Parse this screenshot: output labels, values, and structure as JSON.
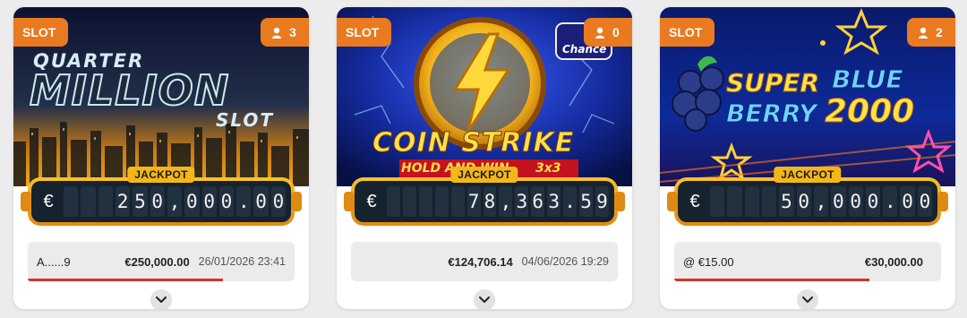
{
  "games": [
    {
      "category": "SLOT",
      "players": "3",
      "art_title": [
        "QUARTER",
        "MILLION",
        "SLOT"
      ],
      "jackpot_label": "JACKPOT",
      "currency": "€",
      "digits": [
        "",
        "",
        "",
        "2",
        "5",
        "0",
        ",",
        "0",
        "0",
        "0",
        ".",
        "0",
        "0"
      ],
      "win": {
        "name": "A......9",
        "amount": "€250,000.00",
        "date": "26/01/2026 23:41",
        "progress": 0.73
      }
    },
    {
      "category": "SLOT",
      "players": "0",
      "art_title": [
        "COIN STRIKE",
        "HOLD AND WIN",
        "3x3",
        "Chance"
      ],
      "jackpot_label": "JACKPOT",
      "currency": "€",
      "digits": [
        "",
        "",
        "",
        "",
        "",
        "7",
        "8",
        ",",
        "3",
        "6",
        "3",
        ".",
        "5",
        "9"
      ],
      "win": {
        "name": "",
        "amount": "€124,706.14",
        "date": "04/06/2026 19:29",
        "progress": 0
      }
    },
    {
      "category": "SLOT",
      "players": "2",
      "art_title": [
        "SUPER",
        "BLUE",
        "BERRY",
        "2000"
      ],
      "jackpot_label": "JACKPOT",
      "currency": "€",
      "digits": [
        "",
        "",
        "",
        "",
        "5",
        "0",
        ",",
        "0",
        "0",
        "0",
        ".",
        "0",
        "0"
      ],
      "win": {
        "name": "@ €15.00",
        "amount": "€30,000.00",
        "date": "",
        "progress": 0.73
      }
    }
  ],
  "colors": {
    "tag": "#e97a1f",
    "jackpot_frame": "#f3b719",
    "jackpot_bg": "#16222e",
    "win_bar": "#d8322c"
  },
  "icons": {
    "players": "person-icon",
    "expand": "chevron-down-icon"
  }
}
